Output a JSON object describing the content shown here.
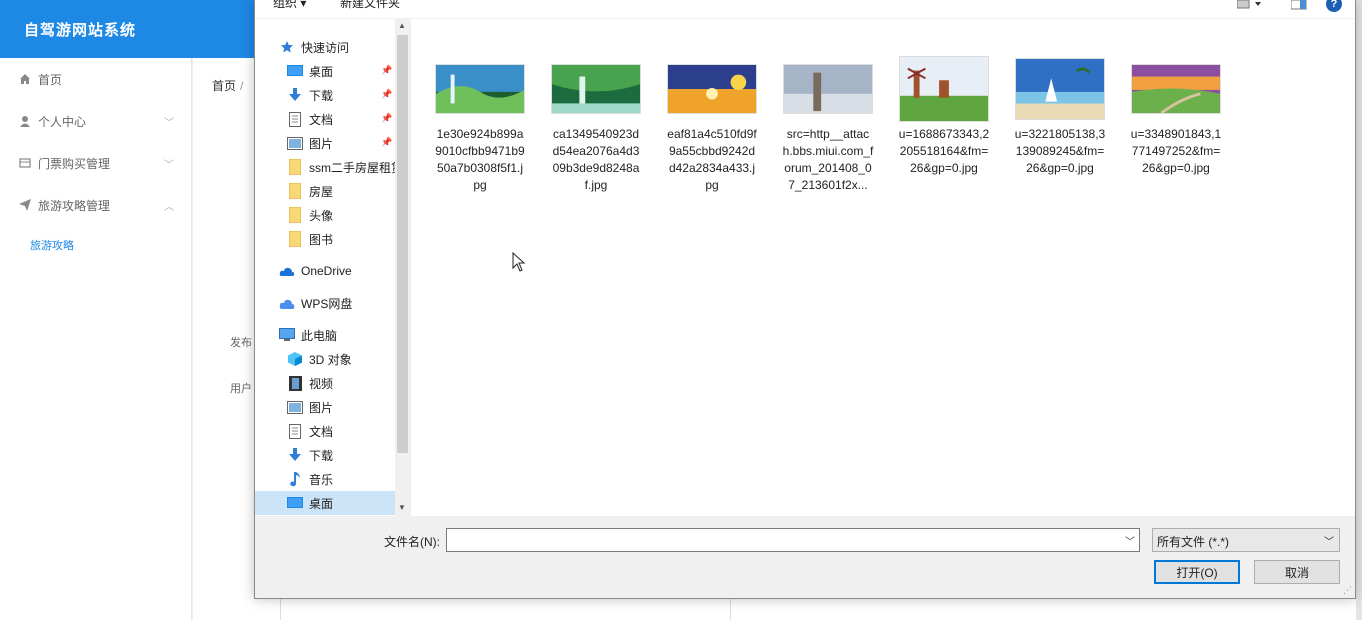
{
  "app": {
    "title": "自驾游网站系统",
    "breadcrumb": {
      "home": "首页",
      "sep": "/"
    },
    "sidebar": [
      {
        "label": "首页",
        "icon": "home-icon"
      },
      {
        "label": "个人中心",
        "icon": "user-icon"
      },
      {
        "label": "门票购买管理",
        "icon": "ticket-icon"
      },
      {
        "label": "旅游攻略管理",
        "icon": "send-icon"
      }
    ],
    "submenu": {
      "label": "旅游攻略"
    },
    "form_labels": {
      "publish": "发布",
      "user": "用户"
    }
  },
  "dialog": {
    "toolbar": {
      "organize": "组织 ▾",
      "new_folder": "新建文件夹",
      "help": "?"
    },
    "nav": [
      {
        "label": "快速访问",
        "icon": "star-icon",
        "pinned": false
      },
      {
        "label": "桌面",
        "icon": "desktop-icon",
        "pinned": true
      },
      {
        "label": "下载",
        "icon": "download-icon",
        "pinned": true
      },
      {
        "label": "文档",
        "icon": "document-icon",
        "pinned": true
      },
      {
        "label": "图片",
        "icon": "picture-icon",
        "pinned": true
      },
      {
        "label": "ssm二手房屋租赁",
        "icon": "folder-icon",
        "pinned": false
      },
      {
        "label": "房屋",
        "icon": "folder-icon",
        "pinned": false
      },
      {
        "label": "头像",
        "icon": "folder-icon",
        "pinned": false
      },
      {
        "label": "图书",
        "icon": "folder-icon",
        "pinned": false
      },
      {
        "label": "OneDrive",
        "icon": "cloud-icon",
        "pinned": false
      },
      {
        "label": "WPS网盘",
        "icon": "wps-cloud-icon",
        "pinned": false
      },
      {
        "label": "此电脑",
        "icon": "computer-icon",
        "pinned": false
      },
      {
        "label": "3D 对象",
        "icon": "cube-icon",
        "pinned": false
      },
      {
        "label": "视频",
        "icon": "video-icon",
        "pinned": false
      },
      {
        "label": "图片",
        "icon": "picture-icon",
        "pinned": false
      },
      {
        "label": "文档",
        "icon": "document-icon",
        "pinned": false
      },
      {
        "label": "下载",
        "icon": "download-icon",
        "pinned": false
      },
      {
        "label": "音乐",
        "icon": "music-icon",
        "pinned": false
      },
      {
        "label": "桌面",
        "icon": "desktop-icon",
        "pinned": false
      }
    ],
    "files": [
      {
        "name": "1e30e924b899a9010cfbb9471b950a7b0308f5f1.jpg",
        "colors": [
          "#3a8fc9",
          "#6fbf5a",
          "#1f5d2f"
        ]
      },
      {
        "name": "ca1349540923dd54ea2076a4d309b3de9d8248af.jpg",
        "colors": [
          "#1c6b3e",
          "#48a34e",
          "#9fd9c8"
        ]
      },
      {
        "name": "eaf81a4c510fd9f9a55cbbd9242dd42a2834a433.jpg",
        "colors": [
          "#2b3f8c",
          "#f0a32b",
          "#f7d34a"
        ]
      },
      {
        "name": "src=http__attach.bbs.miui.com_forum_201408_07_213601f2x...",
        "colors": [
          "#a6b4c8",
          "#d8dee6",
          "#7a6a5c"
        ]
      },
      {
        "name": "u=1688673343,2205518164&fm=26&gp=0.jpg",
        "colors": [
          "#e8eef5",
          "#5fa641",
          "#3c7a2a"
        ]
      },
      {
        "name": "u=3221805138,3139089245&fm=26&gp=0.jpg",
        "colors": [
          "#2f6fc4",
          "#7cc3e8",
          "#e9d9b4"
        ]
      },
      {
        "name": "u=3348901843,1771497252&fm=26&gp=0.jpg",
        "colors": [
          "#f0a040",
          "#6bb04a",
          "#8c4fa0"
        ]
      }
    ],
    "filename": {
      "label": "文件名(N):",
      "value": ""
    },
    "filetype": {
      "selected": "所有文件 (*.*)"
    },
    "buttons": {
      "open": "打开(O)",
      "cancel": "取消"
    }
  }
}
